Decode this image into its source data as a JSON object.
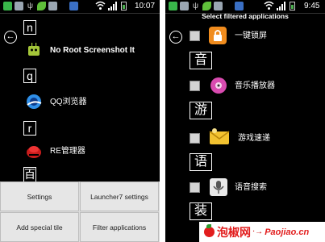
{
  "left": {
    "status_time": "10:07",
    "list": [
      {
        "index_letter": "n",
        "app_name": "No Root Screenshot It",
        "icon": "android-robot-icon"
      },
      {
        "index_letter": "q",
        "app_name": "QQ浏览器",
        "icon": "qq-browser-icon"
      },
      {
        "index_letter": "r",
        "app_name": "RE管理器",
        "icon": "re-manager-icon"
      },
      {
        "index_letter": "百"
      }
    ],
    "menu": {
      "settings": "Settings",
      "launcher_settings": "Launcher7 settings",
      "add_special_tile": "Add special tile",
      "filter_applications": "Filter applications"
    }
  },
  "right": {
    "status_time": "9:45",
    "header_title": "Select filtered applications",
    "list": [
      {
        "kind": "app",
        "app_name": "一键锁屏",
        "icon": "lock-icon"
      },
      {
        "kind": "group",
        "char": "音"
      },
      {
        "kind": "app",
        "app_name": "音乐播放器",
        "icon": "music-player-icon"
      },
      {
        "kind": "group",
        "char": "游"
      },
      {
        "kind": "app",
        "app_name": "游戏速递",
        "icon": "game-express-icon"
      },
      {
        "kind": "group",
        "char": "语"
      },
      {
        "kind": "app",
        "app_name": "语音搜索",
        "icon": "microphone-icon"
      },
      {
        "kind": "group",
        "char": "装"
      }
    ]
  },
  "watermark": {
    "cn": "泡椒网",
    "en": "Paojiao.cn"
  }
}
